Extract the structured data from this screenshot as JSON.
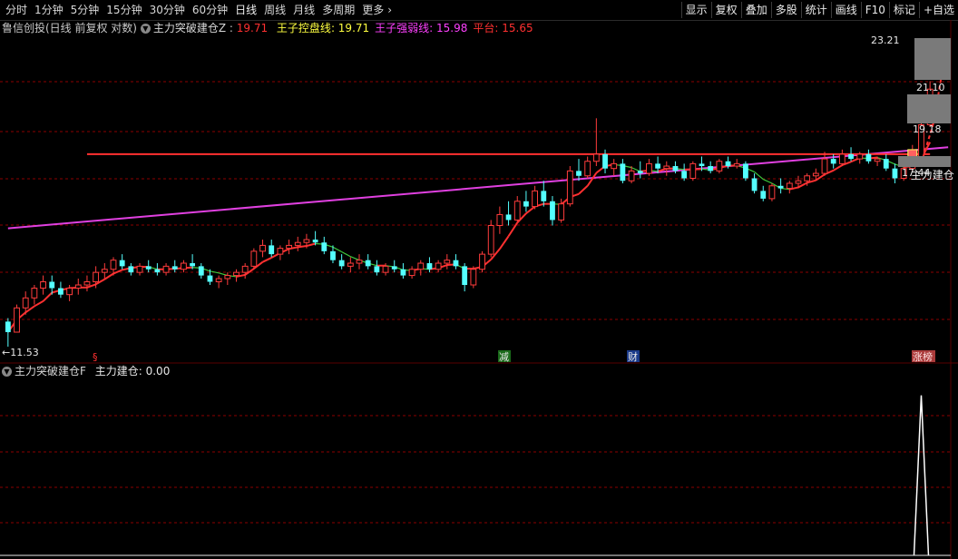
{
  "toolbar": {
    "period_tabs": [
      "分时",
      "1分钟",
      "5分钟",
      "15分钟",
      "30分钟",
      "60分钟",
      "日线",
      "周线",
      "月线",
      "多周期",
      "更多"
    ],
    "active_tab": "日线",
    "more_arrow": "›",
    "tool_buttons": [
      "显示",
      "复权",
      "叠加",
      "多股",
      "统计",
      "画线",
      "F10",
      "标记",
      "+自选"
    ]
  },
  "main_panel": {
    "stock_title": "鲁信创投(日线 前复权 对数)",
    "indicator_name": "主力突破建仓Z",
    "indicator_value": "19.71",
    "items": [
      {
        "label": "王子控盘线",
        "value": "19.71",
        "color": "#ffff40"
      },
      {
        "label": "王子强弱线",
        "value": "15.98",
        "color": "#ff40ff"
      },
      {
        "label": "平台",
        "value": "15.65",
        "color": "#ff3030"
      }
    ],
    "price_labels": [
      "23.21",
      "21.10",
      "19.18",
      "17.44"
    ],
    "low_marker": "11.53",
    "signal_label": "主力建仓",
    "event_markers": [
      "§",
      "减",
      "财",
      "涨榜"
    ]
  },
  "sub_panel": {
    "indicator_name": "主力突破建仓F",
    "items": [
      {
        "label": "主力建仓",
        "value": "0.00"
      }
    ]
  },
  "colors": {
    "up": "#ff3c3c",
    "down": "#54ffff",
    "platform": "#ff3030",
    "strength": "#e040e0",
    "control_up": "#ff3030",
    "control_down": "#3cc83c",
    "grid": "#8b0000",
    "signal_peak": "#ffffff"
  },
  "chart_data": {
    "type": "candlestick",
    "scale": "log",
    "ylim": [
      11.5,
      24.0
    ],
    "candles": [
      [
        12.2,
        12.3,
        11.5,
        11.9
      ],
      [
        11.9,
        12.7,
        11.9,
        12.6
      ],
      [
        12.6,
        13.1,
        12.4,
        12.9
      ],
      [
        12.9,
        13.3,
        12.7,
        13.2
      ],
      [
        13.2,
        13.6,
        13.0,
        13.4
      ],
      [
        13.4,
        13.6,
        13.0,
        13.2
      ],
      [
        13.2,
        13.4,
        12.9,
        13.0
      ],
      [
        13.0,
        13.3,
        12.8,
        13.2
      ],
      [
        13.2,
        13.5,
        13.0,
        13.3
      ],
      [
        13.3,
        13.6,
        13.1,
        13.4
      ],
      [
        13.4,
        13.9,
        13.2,
        13.7
      ],
      [
        13.7,
        14.0,
        13.5,
        13.8
      ],
      [
        13.8,
        14.2,
        13.6,
        14.1
      ],
      [
        14.1,
        14.3,
        13.8,
        13.9
      ],
      [
        13.9,
        14.0,
        13.6,
        13.7
      ],
      [
        13.7,
        14.0,
        13.6,
        13.9
      ],
      [
        13.9,
        14.1,
        13.7,
        13.8
      ],
      [
        13.8,
        14.0,
        13.6,
        13.7
      ],
      [
        13.7,
        14.0,
        13.6,
        13.9
      ],
      [
        13.9,
        14.1,
        13.7,
        13.8
      ],
      [
        13.8,
        14.1,
        13.7,
        14.0
      ],
      [
        14.0,
        14.3,
        13.8,
        13.9
      ],
      [
        13.9,
        14.0,
        13.5,
        13.6
      ],
      [
        13.6,
        13.8,
        13.3,
        13.4
      ],
      [
        13.4,
        13.6,
        13.2,
        13.5
      ],
      [
        13.5,
        13.7,
        13.3,
        13.6
      ],
      [
        13.6,
        13.8,
        13.4,
        13.7
      ],
      [
        13.7,
        14.0,
        13.5,
        13.9
      ],
      [
        13.9,
        14.5,
        13.8,
        14.4
      ],
      [
        14.4,
        14.8,
        14.2,
        14.6
      ],
      [
        14.6,
        14.8,
        14.2,
        14.3
      ],
      [
        14.3,
        14.6,
        14.1,
        14.5
      ],
      [
        14.5,
        14.8,
        14.3,
        14.6
      ],
      [
        14.6,
        14.9,
        14.4,
        14.7
      ],
      [
        14.7,
        15.0,
        14.5,
        14.8
      ],
      [
        14.8,
        15.1,
        14.6,
        14.7
      ],
      [
        14.7,
        14.9,
        14.3,
        14.4
      ],
      [
        14.4,
        14.6,
        14.0,
        14.1
      ],
      [
        14.1,
        14.3,
        13.8,
        13.9
      ],
      [
        13.9,
        14.2,
        13.7,
        14.0
      ],
      [
        14.0,
        14.3,
        13.8,
        14.1
      ],
      [
        14.1,
        14.3,
        13.8,
        13.9
      ],
      [
        13.9,
        14.1,
        13.6,
        13.7
      ],
      [
        13.7,
        14.0,
        13.6,
        13.9
      ],
      [
        13.9,
        14.1,
        13.7,
        13.8
      ],
      [
        13.8,
        14.0,
        13.5,
        13.6
      ],
      [
        13.6,
        13.9,
        13.5,
        13.8
      ],
      [
        13.8,
        14.1,
        13.6,
        14.0
      ],
      [
        14.0,
        14.2,
        13.7,
        13.8
      ],
      [
        13.8,
        14.1,
        13.7,
        14.0
      ],
      [
        14.0,
        14.3,
        13.8,
        14.1
      ],
      [
        14.1,
        14.3,
        13.8,
        13.9
      ],
      [
        13.9,
        14.0,
        13.1,
        13.3
      ],
      [
        13.3,
        13.9,
        13.2,
        13.8
      ],
      [
        13.8,
        14.4,
        13.7,
        14.3
      ],
      [
        14.3,
        15.5,
        14.2,
        15.3
      ],
      [
        15.3,
        16.0,
        15.0,
        15.7
      ],
      [
        15.7,
        16.2,
        15.3,
        15.5
      ],
      [
        15.5,
        16.4,
        15.4,
        16.2
      ],
      [
        16.2,
        16.6,
        15.8,
        16.0
      ],
      [
        16.0,
        16.8,
        15.9,
        16.6
      ],
      [
        16.6,
        17.0,
        16.0,
        16.2
      ],
      [
        16.2,
        16.4,
        15.3,
        15.5
      ],
      [
        15.5,
        16.3,
        15.4,
        16.1
      ],
      [
        16.1,
        17.6,
        16.0,
        17.4
      ],
      [
        17.4,
        17.9,
        17.0,
        17.2
      ],
      [
        17.2,
        18.0,
        17.1,
        17.8
      ],
      [
        17.8,
        19.7,
        17.6,
        18.1
      ],
      [
        18.1,
        18.3,
        17.3,
        17.5
      ],
      [
        17.5,
        17.9,
        17.2,
        17.7
      ],
      [
        17.7,
        17.9,
        16.9,
        17.0
      ],
      [
        17.0,
        17.6,
        16.9,
        17.4
      ],
      [
        17.4,
        17.8,
        17.1,
        17.3
      ],
      [
        17.3,
        17.9,
        17.2,
        17.7
      ],
      [
        17.7,
        18.0,
        17.3,
        17.5
      ],
      [
        17.5,
        17.8,
        17.2,
        17.6
      ],
      [
        17.6,
        17.8,
        17.3,
        17.4
      ],
      [
        17.4,
        17.7,
        17.0,
        17.1
      ],
      [
        17.1,
        17.8,
        17.0,
        17.7
      ],
      [
        17.7,
        18.0,
        17.4,
        17.6
      ],
      [
        17.6,
        17.8,
        17.3,
        17.4
      ],
      [
        17.4,
        17.9,
        17.3,
        17.8
      ],
      [
        17.8,
        18.0,
        17.5,
        17.6
      ],
      [
        17.6,
        17.9,
        17.5,
        17.7
      ],
      [
        17.7,
        17.8,
        17.0,
        17.1
      ],
      [
        17.1,
        17.3,
        16.5,
        16.6
      ],
      [
        16.6,
        16.8,
        16.2,
        16.3
      ],
      [
        16.3,
        16.9,
        16.2,
        16.8
      ],
      [
        16.8,
        17.1,
        16.5,
        16.7
      ],
      [
        16.7,
        17.0,
        16.5,
        16.9
      ],
      [
        16.9,
        17.2,
        16.7,
        17.0
      ],
      [
        17.0,
        17.3,
        16.8,
        17.2
      ],
      [
        17.2,
        17.5,
        17.0,
        17.3
      ],
      [
        17.3,
        18.2,
        17.2,
        17.9
      ],
      [
        17.9,
        18.1,
        17.5,
        17.7
      ],
      [
        17.7,
        18.3,
        17.6,
        18.1
      ],
      [
        18.1,
        18.4,
        17.8,
        17.9
      ],
      [
        17.9,
        18.2,
        17.7,
        18.1
      ],
      [
        18.1,
        18.3,
        17.7,
        17.8
      ],
      [
        17.8,
        18.0,
        17.6,
        17.9
      ],
      [
        17.9,
        18.1,
        17.4,
        17.5
      ],
      [
        17.5,
        17.7,
        16.9,
        17.1
      ],
      [
        17.1,
        17.6,
        17.0,
        17.5
      ],
      [
        17.5,
        18.5,
        17.4,
        18.0
      ],
      [
        18.0,
        19.8,
        17.9,
        19.4
      ],
      [
        19.4,
        21.5,
        19.3,
        21.1
      ]
    ],
    "platform_level": 18.1,
    "platform_range": [
      9,
      109
    ],
    "strength_line": {
      "x": [
        0,
        109
      ],
      "y": [
        15.2,
        18.4
      ]
    },
    "sub_signal": {
      "index": 104,
      "value": 1.0
    },
    "sub_ylim": [
      0,
      1.1
    ]
  }
}
